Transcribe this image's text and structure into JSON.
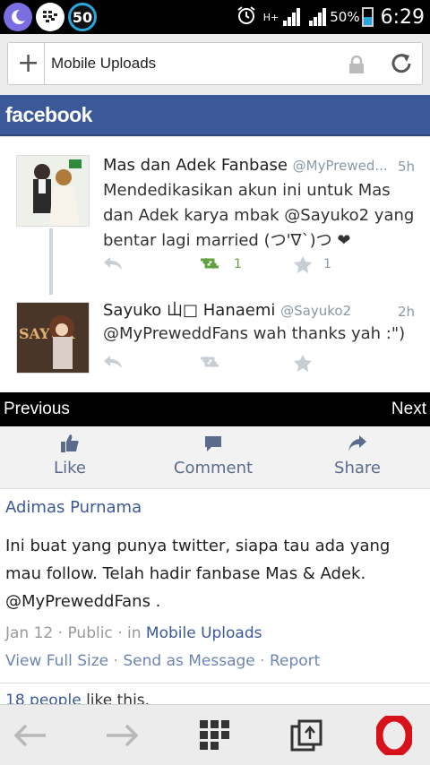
{
  "status_bar": {
    "notification_count": "50",
    "network_type": "H+",
    "battery": "50%",
    "time": "6:29"
  },
  "browser": {
    "address": "Mobile Uploads"
  },
  "site": {
    "logo": "facebook",
    "brand_color": "#3b5998"
  },
  "tweets": [
    {
      "name": "Mas dan Adek Fanbase",
      "handle": "@MyPrewed...",
      "time": "5h",
      "lines": [
        "Mendedikasikan akun ini untuk Mas",
        "dan Adek karya mbak @Sayuko2 yang",
        "bentar lagi married (つ'∇`)つ ❤"
      ],
      "retweets": "1",
      "favorites": "1"
    },
    {
      "name": "Sayuko 山□ Hanaemi",
      "handle": "@Sayuko2",
      "time": "2h",
      "lines": [
        "@MyPreweddFans wah thanks yah :\")"
      ]
    }
  ],
  "pager": {
    "previous": "Previous",
    "next": "Next"
  },
  "actions": {
    "like": "Like",
    "comment": "Comment",
    "share": "Share"
  },
  "post": {
    "author": "Adimas Purnama",
    "text": "Ini buat yang punya twitter, siapa tau ada yang mau follow. Telah hadir fanbase Mas & Adek. @MyPreweddFans .",
    "date": "Jan 12",
    "privacy": "Public",
    "in_label": "in",
    "album": "Mobile Uploads",
    "link_full_size": "View Full Size",
    "link_send": "Send as Message",
    "link_report": "Report",
    "likes_link": "18 people",
    "likes_suffix": "like this."
  }
}
